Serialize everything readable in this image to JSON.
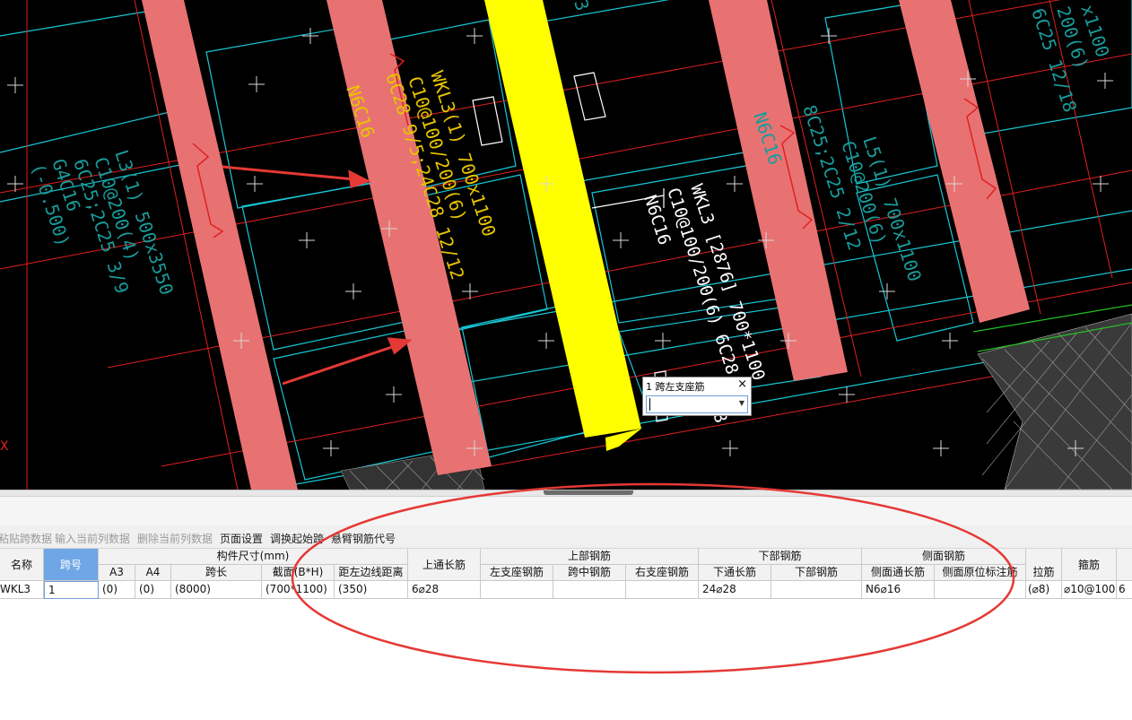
{
  "cad": {
    "annotations": {
      "left_beam": [
        "L3(1) 500x3550",
        "C10@200(4)",
        "6C25;2C25 3/9",
        "G4C16",
        "(-0.500)"
      ],
      "wkl3_yellow": [
        "WKL3(1) 700x1100",
        "C10@100/200(6)",
        "6C28 9/5;24C28 12/12",
        "N6C16"
      ],
      "wkl3_white": [
        "WKL3 [2876] 700*1100",
        "C10@100/200(6) 6C28;",
        "N6C16"
      ],
      "l5_beam": [
        "L5(1) 700x1100",
        "C10@200(6)",
        "8C25;2C25 2/12",
        "N6C16"
      ],
      "right_beam": [
        "x1100",
        "200(6)",
        "6C25 12/18"
      ],
      "top_fragment": "3",
      "edge_mark": "X",
      "white_tail": "8"
    },
    "popup": {
      "title": "1 跨左支座筋",
      "close": "×",
      "value": ""
    }
  },
  "toolbar": {
    "paste": "粘贴跨数据",
    "input_col": "输入当前列数据",
    "delete_col": "删除当前列数据",
    "page_setup": "页面设置",
    "swap_start": "调换起始跨",
    "cantilever": "悬臂钢筋代号"
  },
  "table": {
    "headers": {
      "name": "名称",
      "span": "跨号",
      "size_group": "构件尺寸(mm)",
      "a3": "A3",
      "a4": "A4",
      "span_len": "跨长",
      "section": "截面(B*H)",
      "edge_dist": "距左边线距离",
      "top_cont": "上通长筋",
      "top_group": "上部钢筋",
      "left_support": "左支座钢筋",
      "mid": "跨中钢筋",
      "right_support": "右支座钢筋",
      "bottom_group": "下部钢筋",
      "bottom_cont": "下通长筋",
      "bottom": "下部钢筋",
      "side_group": "侧面钢筋",
      "side_cont": "侧面通长筋",
      "side_orig": "侧面原位标注筋",
      "tie": "拉筋",
      "stirrup": "箍筋"
    },
    "row": {
      "name": "WKL3",
      "span": "1",
      "a3": "(0)",
      "a4": "(0)",
      "span_len": "(8000)",
      "section": "(700*1100)",
      "edge_dist": "(350)",
      "top_cont": "6⌀28",
      "left_support": "",
      "mid": "",
      "right_support": "",
      "bottom_cont": "24⌀28",
      "bottom": "",
      "side_cont": "N6⌀16",
      "side_orig": "",
      "tie": "(⌀8)",
      "stirrup": "⌀10@100",
      "extra": "6"
    }
  },
  "colors": {
    "canvas": "#000000",
    "beam_pink": "#e87272",
    "beam_yellow": "#ffff00",
    "cyan_lines": "#17c7d6",
    "red_lines": "#e02020",
    "yellow_text": "#e8c400",
    "teal_text": "#1a9b9b",
    "annotation_ellipse": "#e53935",
    "selected_header": "#6fa7e6"
  }
}
